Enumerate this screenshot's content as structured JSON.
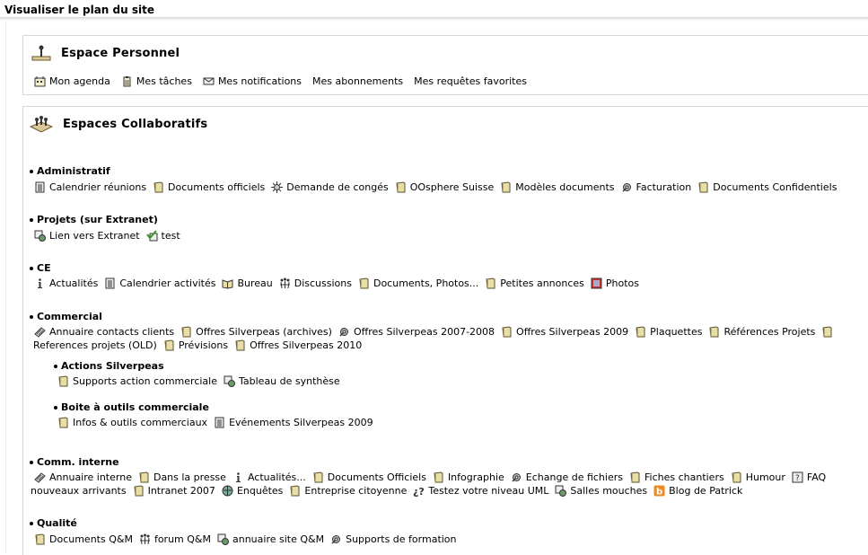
{
  "page_title": "Visualiser le plan du site",
  "perso": {
    "title": "Espace Personnel",
    "links": [
      {
        "label": "Mon agenda",
        "icon": "agenda-icon"
      },
      {
        "label": "Mes tâches",
        "icon": "tasks-icon"
      },
      {
        "label": "Mes notifications",
        "icon": "envelope-icon"
      },
      {
        "label": "Mes abonnements",
        "icon": ""
      },
      {
        "label": "Mes requêtes favorites",
        "icon": ""
      }
    ]
  },
  "collab": {
    "title": "Espaces Collaboratifs",
    "sections": [
      {
        "title": "Administratif",
        "lines": [
          [
            {
              "label": "Calendrier réunions",
              "icon": "calendar-icon"
            },
            {
              "label": "Documents officiels",
              "icon": "folder-icon"
            },
            {
              "label": "Demande de congés",
              "icon": "workflow-icon"
            },
            {
              "label": "OOsphere Suisse",
              "icon": "folder-icon"
            },
            {
              "label": "Modèles documents",
              "icon": "folder-icon"
            },
            {
              "label": "Facturation",
              "icon": "gear-icon"
            },
            {
              "label": "Documents Confidentiels",
              "icon": "folder-icon"
            }
          ]
        ]
      },
      {
        "title": "Projets (sur Extranet)",
        "lines": [
          [
            {
              "label": "Lien vers Extranet",
              "icon": "web-link-icon"
            },
            {
              "label": "test",
              "icon": "check-icon"
            }
          ]
        ]
      },
      {
        "title": "CE",
        "lines": [
          [
            {
              "label": "Actualités",
              "icon": "info-icon"
            },
            {
              "label": "Calendrier activités",
              "icon": "calendar-icon"
            },
            {
              "label": "Bureau",
              "icon": "book-icon"
            },
            {
              "label": "Discussions",
              "icon": "forum-icon"
            },
            {
              "label": "Documents, Photos...",
              "icon": "folder-icon"
            },
            {
              "label": "Petites annonces",
              "icon": "folder-icon"
            },
            {
              "label": "Photos",
              "icon": "film-icon"
            }
          ]
        ]
      },
      {
        "title": "Commercial",
        "lines": [
          [
            {
              "label": "Annuaire contacts clients",
              "icon": "directory-icon"
            },
            {
              "label": "Offres Silverpeas (archives)",
              "icon": "folder-icon"
            },
            {
              "label": "Offres Silverpeas 2007-2008",
              "icon": "gear-icon"
            },
            {
              "label": "Offres Silverpeas 2009",
              "icon": "folder-icon"
            },
            {
              "label": "Plaquettes",
              "icon": "folder-icon"
            },
            {
              "label": "Références Projets",
              "icon": "folder-icon"
            },
            {
              "label": "",
              "icon": "folder-icon"
            }
          ],
          [
            {
              "label": "References projets (OLD)",
              "icon": ""
            },
            {
              "label": "Prévisions",
              "icon": "folder-icon"
            },
            {
              "label": "Offres Silverpeas 2010",
              "icon": "folder-icon"
            }
          ]
        ]
      },
      {
        "title": "Actions Silverpeas",
        "sub": true,
        "lines": [
          [
            {
              "label": "Supports action commerciale",
              "icon": "folder-icon"
            },
            {
              "label": "Tableau de synthèse",
              "icon": "web-link-icon"
            }
          ]
        ]
      },
      {
        "title": "Boite à outils commerciale",
        "sub": true,
        "lines": [
          [
            {
              "label": "Infos & outils commerciaux",
              "icon": "folder-icon"
            },
            {
              "label": "Evénements Silverpeas 2009",
              "icon": "calendar-icon"
            }
          ]
        ]
      },
      {
        "title": "Comm. interne",
        "lines": [
          [
            {
              "label": "Annuaire interne",
              "icon": "directory-icon"
            },
            {
              "label": "Dans la presse",
              "icon": "folder-icon"
            },
            {
              "label": "Actualités...",
              "icon": "info-icon"
            },
            {
              "label": "Documents Officiels",
              "icon": "folder-icon"
            },
            {
              "label": "Infographie",
              "icon": "folder-icon"
            },
            {
              "label": "Echange de fichiers",
              "icon": "gear-icon"
            },
            {
              "label": "Fiches chantiers",
              "icon": "folder-icon"
            },
            {
              "label": "Humour",
              "icon": "folder-icon"
            },
            {
              "label": "FAQ",
              "icon": "faq-icon"
            }
          ],
          [
            {
              "label": "nouveaux arrivants",
              "icon": ""
            },
            {
              "label": "Intranet 2007",
              "icon": "folder-icon"
            },
            {
              "label": "Enquêtes",
              "icon": "survey-icon"
            },
            {
              "label": "Entreprise citoyenne",
              "icon": "folder-icon"
            },
            {
              "label": "Testez votre niveau UML",
              "icon": "quiz-icon"
            },
            {
              "label": "Salles mouches",
              "icon": "web-link-icon"
            },
            {
              "label": "Blog de Patrick",
              "icon": "blog-icon"
            }
          ]
        ]
      },
      {
        "title": "Qualité",
        "lines": [
          [
            {
              "label": "Documents Q&M",
              "icon": "folder-icon"
            },
            {
              "label": "forum Q&M",
              "icon": "forum-icon"
            },
            {
              "label": "annuaire site Q&M",
              "icon": "web-link-icon"
            },
            {
              "label": "Supports de formation",
              "icon": "gear-icon"
            }
          ]
        ]
      }
    ]
  }
}
